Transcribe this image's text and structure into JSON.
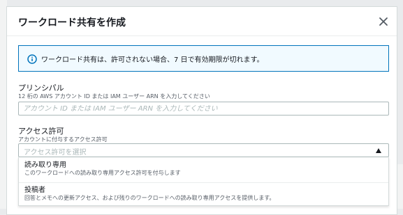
{
  "modal": {
    "title": "ワークロード共有を作成"
  },
  "alert": {
    "icon": "info-icon",
    "text": "ワークロード共有は、許可されない場合、7 日で有効期限が切れます。",
    "border_color": "#0073bb",
    "background_color": "#f1faff"
  },
  "principal": {
    "label": "プリンシパル",
    "description": "12 桁の AWS アカウント ID または IAM ユーザー ARN を入力してください",
    "placeholder": "アカウント ID または IAM ユーザー ARN を入力してください",
    "value": ""
  },
  "permission": {
    "label": "アクセス許可",
    "description": "アカウントに付与するアクセス許可",
    "placeholder": "アクセス許可を選択",
    "options": [
      {
        "label": "読み取り専用",
        "description": "このワークロードへの読み取り専用アクセス許可を付与します"
      },
      {
        "label": "投稿者",
        "description": "回答とメモへの更新アクセス、および残りのワークロードへの読み取り専用アクセスを提供します。"
      }
    ]
  }
}
